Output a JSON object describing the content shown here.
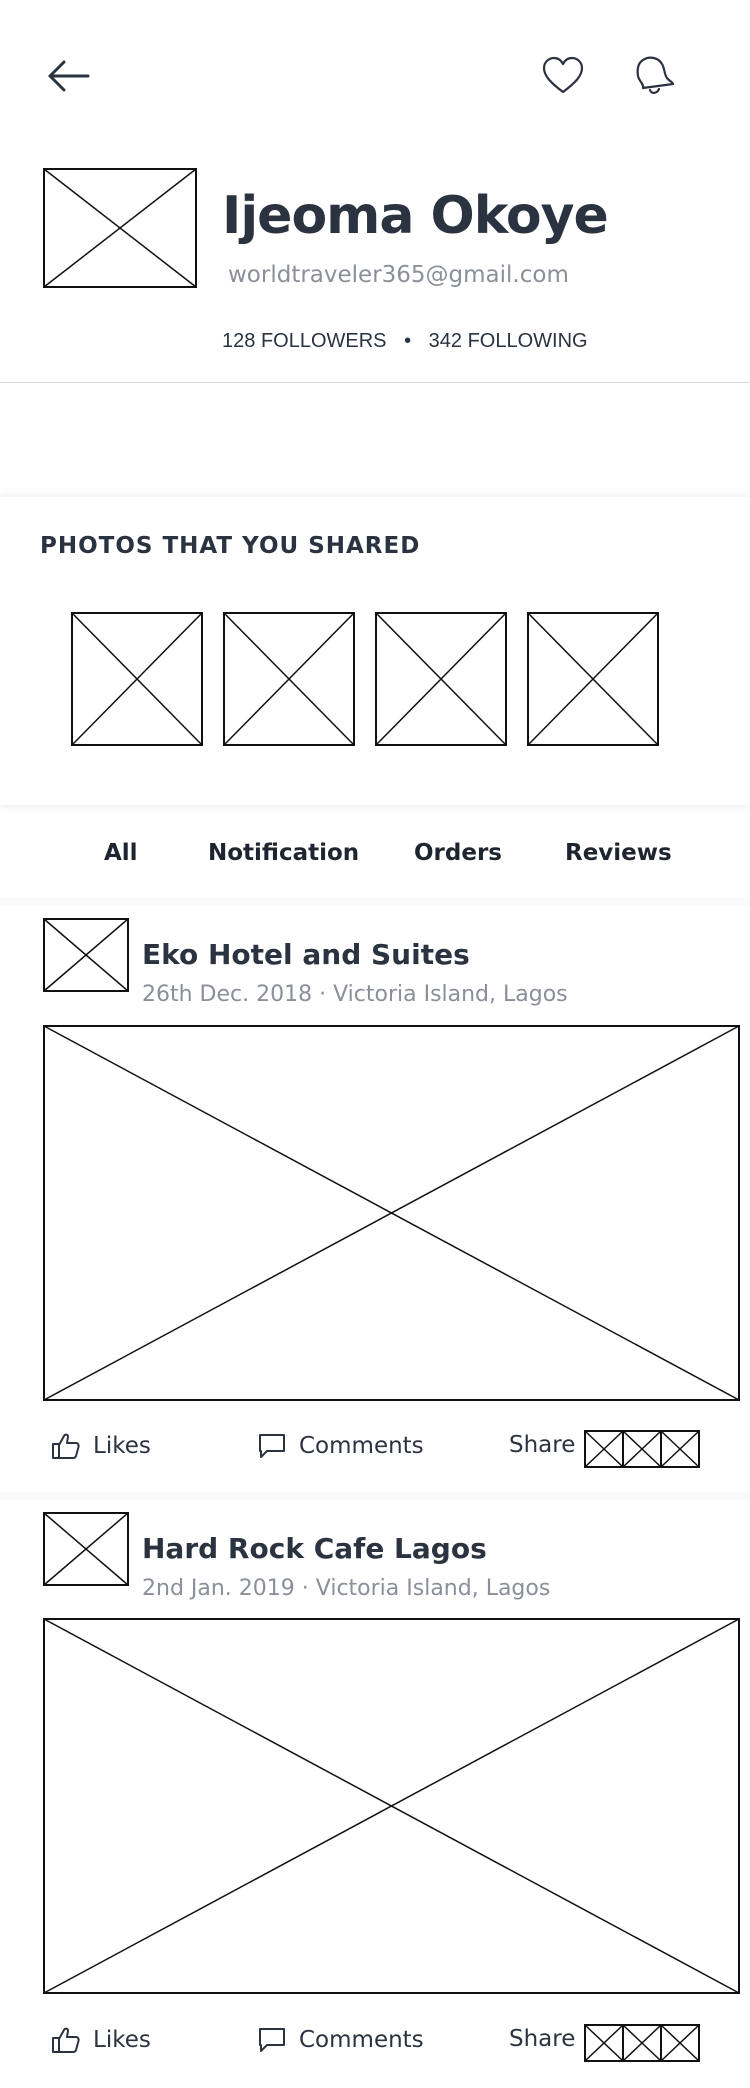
{
  "profile": {
    "name": "Ijeoma Okoye",
    "email": "worldtraveler365@gmail.com",
    "followers_count": "128",
    "followers_label": "FOLLOWERS",
    "separator": "•",
    "following_count": "342",
    "following_label": "FOLLOWING"
  },
  "header_icons": [
    "arrow-left-icon",
    "heart-icon",
    "bell-icon"
  ],
  "photos": {
    "heading": "PHOTOS THAT YOU SHARED"
  },
  "tabs": [
    {
      "label": "All"
    },
    {
      "label": "Notification"
    },
    {
      "label": "Orders"
    },
    {
      "label": "Reviews"
    }
  ],
  "posts": [
    {
      "title": "Eko Hotel and Suites",
      "meta": "26th Dec. 2018 · Victoria Island, Lagos",
      "likes_label": "Likes",
      "comments_label": "Comments",
      "share_label": "Share"
    },
    {
      "title": "Hard Rock Cafe Lagos",
      "meta": "2nd Jan. 2019 · Victoria Island, Lagos",
      "likes_label": "Likes",
      "comments_label": "Comments",
      "share_label": "Share"
    }
  ],
  "colors": {
    "text": "#2b3340",
    "muted": "#8a8f99",
    "divider": "#d6d8dc"
  }
}
